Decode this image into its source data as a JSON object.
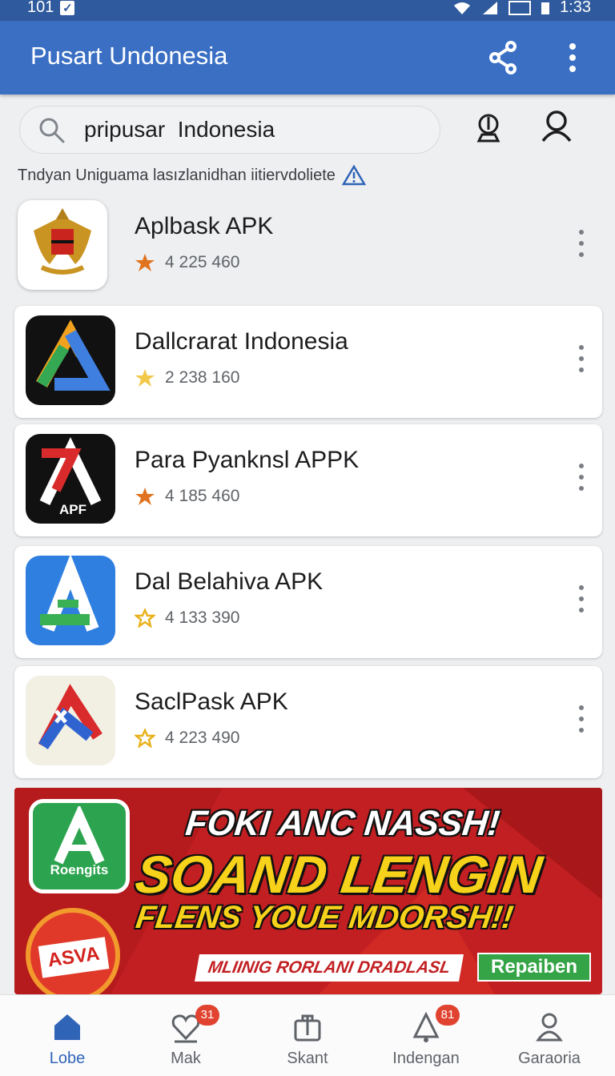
{
  "status_bar": {
    "time": "1:33",
    "left_text": "101",
    "check_icon": "check-box-icon"
  },
  "app_bar": {
    "title": "Pusart Undonesia",
    "share_icon": "share-icon",
    "more_icon": "more-vert-icon"
  },
  "search": {
    "value": "pripusar  Indonesia",
    "placeholder": "",
    "mic_icon": "mic-icon",
    "profile_icon": "profile-icon"
  },
  "subtitle": "Tndyan Uniguama lasızlanidhan iitiervdoliete",
  "apps": [
    {
      "name": "Aplbask APK",
      "rating": "4 225 460",
      "star": "filled"
    },
    {
      "name": "Dallcrarat Indonesia",
      "rating": "2 238 160",
      "star": "light"
    },
    {
      "name": "Para Pyanknsl APPK",
      "rating": "4 185 460",
      "star": "filled"
    },
    {
      "name": "Dal Belahiva APK",
      "rating": "4 133 390",
      "star": "outline"
    },
    {
      "name": "SaclPask APK",
      "rating": "4 223 490",
      "star": "outline"
    }
  ],
  "app_icon_text": {
    "apk": "APF"
  },
  "banner": {
    "logo_text": "Roengits",
    "badge_text": "ASVA",
    "line1": "FOKI ANC NASSH!",
    "line2": "SOAND LENGIN",
    "line3": "FLENS YOUE MDORSH!!",
    "tagline": "MLIINIG RORLANI DRADLASL",
    "button": "Repaiben"
  },
  "bottom_nav": [
    {
      "label": "Lobe",
      "icon": "home-icon",
      "active": true,
      "badge": ""
    },
    {
      "label": "Mak",
      "icon": "heart-icon",
      "active": false,
      "badge": "31"
    },
    {
      "label": "Skant",
      "icon": "bag-icon",
      "active": false,
      "badge": ""
    },
    {
      "label": "Indengan",
      "icon": "bell-icon",
      "active": false,
      "badge": "81"
    },
    {
      "label": "Garaoria",
      "icon": "person-icon",
      "active": false,
      "badge": ""
    }
  ],
  "colors": {
    "primary": "#3a6fc4",
    "status": "#2f5a9d",
    "star_filled": "#e0731f",
    "star_light": "#f2c84b",
    "banner": "#c21f22"
  }
}
